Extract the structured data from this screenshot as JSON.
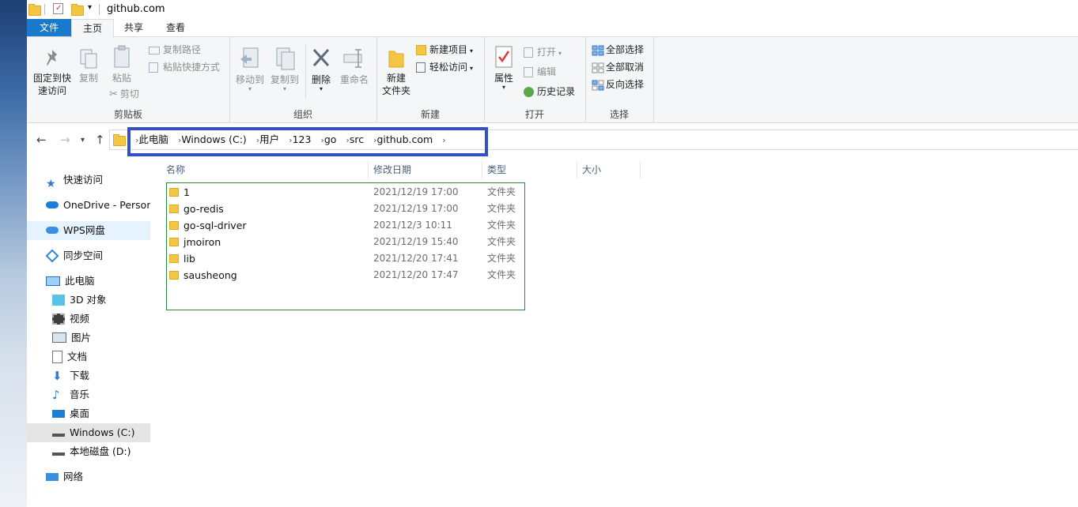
{
  "window": {
    "title": "github.com"
  },
  "tabs": [
    "文件",
    "主页",
    "共享",
    "查看"
  ],
  "ribbon": {
    "clipboard": {
      "label": "剪贴板",
      "pin": "固定到快",
      "pin2": "速访问",
      "copy": "复制",
      "paste": "粘贴",
      "copy_path": "复制路径",
      "paste_shortcut": "粘贴快捷方式",
      "cut": "剪切"
    },
    "organize": {
      "label": "组织",
      "move_to": "移动到",
      "copy_to": "复制到",
      "delete": "删除",
      "rename": "重命名"
    },
    "new": {
      "label": "新建",
      "new_folder": "新建",
      "new_folder2": "文件夹",
      "new_item": "新建项目",
      "easy_access": "轻松访问"
    },
    "open": {
      "label": "打开",
      "properties": "属性",
      "open": "打开",
      "edit": "编辑",
      "history": "历史记录"
    },
    "select": {
      "label": "选择",
      "select_all": "全部选择",
      "select_none": "全部取消",
      "invert": "反向选择"
    }
  },
  "breadcrumb": [
    "此电脑",
    "Windows (C:)",
    "用户",
    "123",
    "go",
    "src",
    "github.com"
  ],
  "sidebar": {
    "items": [
      {
        "label": "快速访问",
        "icon": "star-icon"
      },
      {
        "label": "OneDrive - Persona",
        "icon": "cloud-icon"
      },
      {
        "label": "WPS网盘",
        "icon": "cloud-icon"
      },
      {
        "label": "同步空间",
        "icon": "sync-icon"
      },
      {
        "label": "此电脑",
        "icon": "computer-icon"
      },
      {
        "label": "3D 对象",
        "icon": "cube-icon"
      },
      {
        "label": "视频",
        "icon": "film-icon"
      },
      {
        "label": "图片",
        "icon": "picture-icon"
      },
      {
        "label": "文档",
        "icon": "document-icon"
      },
      {
        "label": "下载",
        "icon": "download-icon"
      },
      {
        "label": "音乐",
        "icon": "music-icon"
      },
      {
        "label": "桌面",
        "icon": "desktop-icon"
      },
      {
        "label": "Windows (C:)",
        "icon": "drive-icon"
      },
      {
        "label": "本地磁盘 (D:)",
        "icon": "drive-icon"
      },
      {
        "label": "网络",
        "icon": "network-icon"
      }
    ]
  },
  "columns": {
    "name": "名称",
    "date": "修改日期",
    "type": "类型",
    "size": "大小"
  },
  "files": [
    {
      "name": "1",
      "date": "2021/12/19 17:00",
      "type": "文件夹"
    },
    {
      "name": "go-redis",
      "date": "2021/12/19 17:00",
      "type": "文件夹"
    },
    {
      "name": "go-sql-driver",
      "date": "2021/12/3 10:11",
      "type": "文件夹"
    },
    {
      "name": "jmoiron",
      "date": "2021/12/19 15:40",
      "type": "文件夹"
    },
    {
      "name": "lib",
      "date": "2021/12/20 17:41",
      "type": "文件夹"
    },
    {
      "name": "sausheong",
      "date": "2021/12/20 17:47",
      "type": "文件夹"
    }
  ],
  "colors": {
    "accent": "#1979ca",
    "highlight_box": "#3450c7",
    "selection_box": "#2c8a3e"
  }
}
